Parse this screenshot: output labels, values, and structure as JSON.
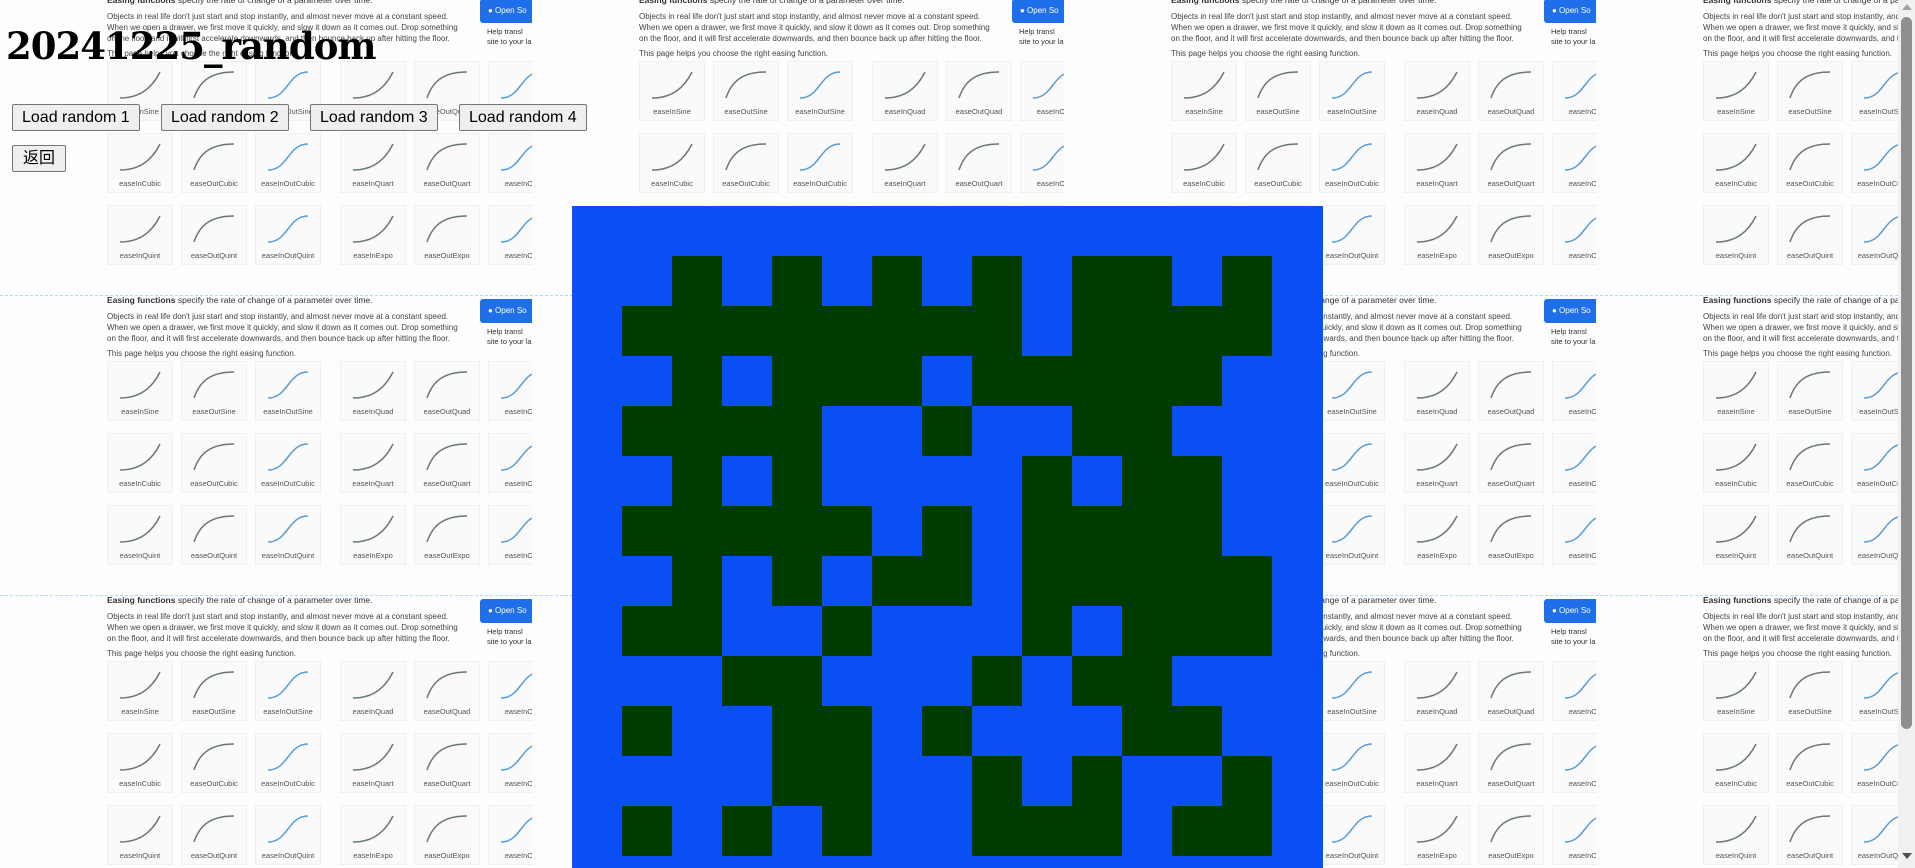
{
  "page": {
    "title": "20241225_random"
  },
  "buttons": [
    {
      "label": "Load random 1"
    },
    {
      "label": "Load random 2"
    },
    {
      "label": "Load random 3"
    },
    {
      "label": "Load random 4"
    }
  ],
  "back_button": {
    "label": "返回"
  },
  "background_screenshot": {
    "heading_bold": "Easing functions",
    "heading_rest": " specify the rate of change of a parameter over time.",
    "paragraph_lines": [
      "Objects in real life don't just start and stop instantly, and almost never move at a constant speed.",
      "When we open a drawer, we first move it quickly, and slow it down as it comes out. Drop something",
      "on the floor, and it will first accelerate downwards, and then bounce back up after hitting the floor.",
      "This page helps you choose the right easing function."
    ],
    "github_button": "Open So",
    "help_lines": [
      "Help transl",
      "site to your lan"
    ],
    "easing_labels": [
      [
        "easeInSine",
        "easeOutSine",
        "easeInOutSine",
        "easeInQuad",
        "easeOutQuad",
        "easeInOu"
      ],
      [
        "easeInCubic",
        "easeOutCubic",
        "easeInOutCubic",
        "easeInQuart",
        "easeOutQuart",
        "easeInOu"
      ],
      [
        "easeInQuint",
        "easeOutQuint",
        "easeInOutQuint",
        "easeInExpo",
        "easeOutExpo",
        "easeInOu"
      ]
    ]
  },
  "random_grid": {
    "colors": {
      "on": "#003c00",
      "off": "#0a50f5"
    },
    "rows": [
      "0101010101101",
      "1111111101111",
      "0101110111110",
      "1111001001100",
      "0101000010110",
      "1111101011110",
      "0101011011111",
      "1100100010111",
      "0011000101100",
      "1001101000110",
      "0001100101001",
      "1010100111011"
    ]
  },
  "scrollbar": {
    "thumb_fraction": 0.84
  }
}
